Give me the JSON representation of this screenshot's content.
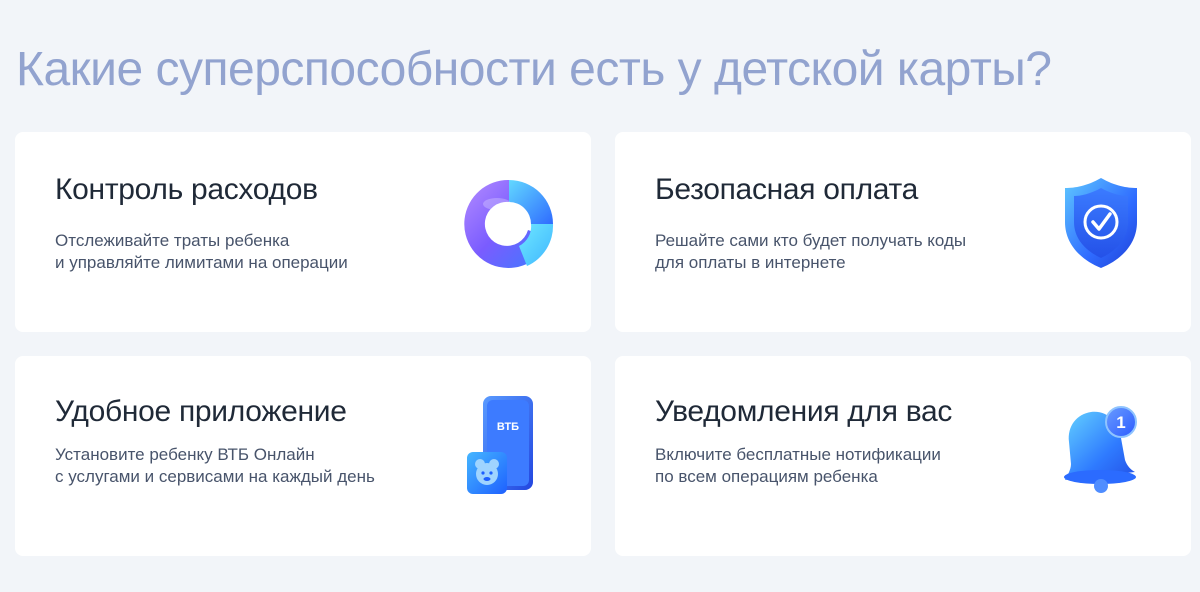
{
  "heading": "Какие суперспособности есть у детской карты?",
  "cards": [
    {
      "title": "Контроль расходов",
      "desc_line1": "Отслеживайте траты ребенка",
      "desc_line2": "и управляйте лимитами на операции",
      "icon": "donut-chart-icon"
    },
    {
      "title": "Безопасная оплата",
      "desc_line1": "Решайте сами кто будет получать коды",
      "desc_line2": "для оплаты в интернете",
      "icon": "shield-check-icon"
    },
    {
      "title": "Удобное приложение",
      "desc_line1": "Установите ребенку ВТБ Онлайн",
      "desc_line2": "с услугами и сервисами на каждый день",
      "icon": "phone-app-icon",
      "phone_brand": "ВТБ"
    },
    {
      "title": "Уведомления для вас",
      "desc_line1": "Включите бесплатные нотификации",
      "desc_line2": "по всем операциям ребенка",
      "icon": "bell-notification-icon",
      "badge_count": "1"
    }
  ],
  "colors": {
    "page_bg": "#f2f5f9",
    "heading": "#92a3cf",
    "card_bg": "#ffffff",
    "title": "#1f2937",
    "desc": "#48546b",
    "accent_blue": "#2f6bff",
    "accent_violet": "#8a5cf6"
  }
}
